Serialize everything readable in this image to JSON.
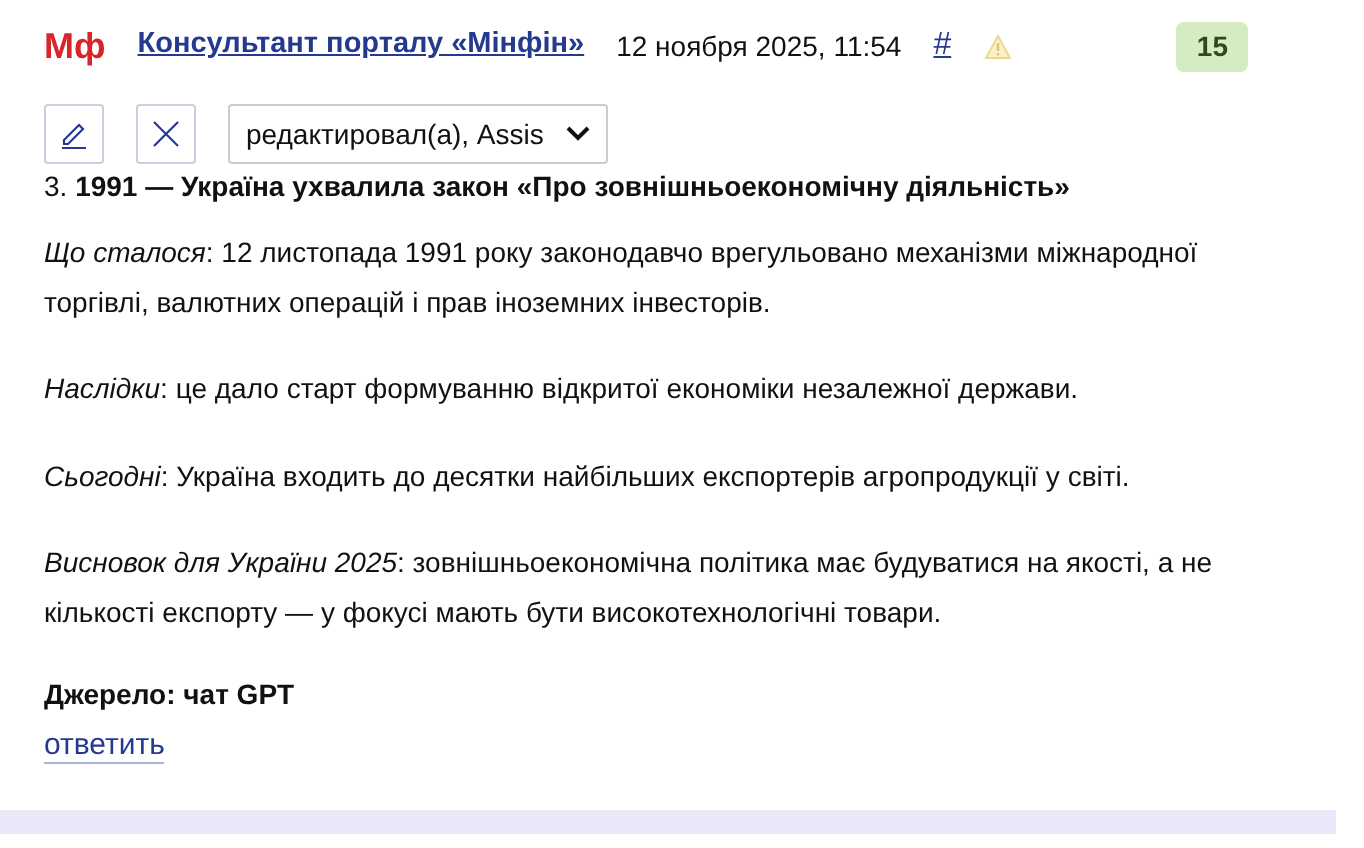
{
  "header": {
    "logo": "Мф",
    "author": "Консультант порталу «Мінфін»",
    "date": "12 ноября 2025, 11:54",
    "anchor": "#",
    "score": "15"
  },
  "toolbar": {
    "edit_select": "редактировал(а), Assis"
  },
  "paragraphs": [
    "3. **1991 — Україна ухвалила закон «Про зовнішньоекономічну діяльність»**",
    "*Що сталося*: 12 листопада 1991 року законодавчо врегульовано механізми міжнародної торгівлі, валютних операцій і прав іноземних інвесторів.",
    "*Наслідки*: це дало старт формуванню відкритої економіки незалежної держави.",
    "*Сьогодні*: Україна входить до десятки найбільших експортерів агропродукції у світі.",
    "*Висновок для України 2025*: зовнішньоекономічна політика має будуватися на якості, а не кількості експорту — у фокусі мають бути високотехнологічні товари."
  ],
  "source": "Джерело: чат GPT",
  "reply_link": "ответить"
}
